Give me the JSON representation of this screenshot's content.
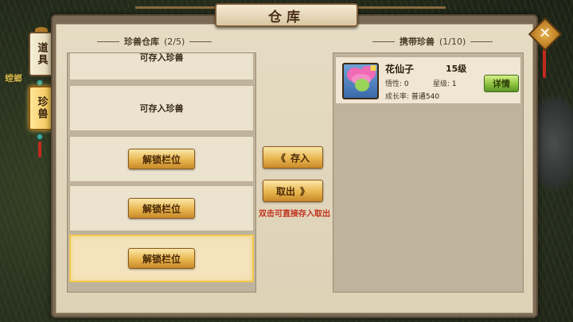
{
  "window": {
    "title": "仓库"
  },
  "side_tabs": [
    {
      "label": "道具",
      "active": false
    },
    {
      "label": "珍兽",
      "active": true
    }
  ],
  "background_label": "螳螂",
  "left": {
    "header": "珍兽仓库",
    "count": "(2/5)",
    "slots": [
      {
        "type": "empty",
        "text": "可存入珍兽"
      },
      {
        "type": "empty",
        "text": "可存入珍兽"
      },
      {
        "type": "locked",
        "button": "解锁栏位"
      },
      {
        "type": "locked",
        "button": "解锁栏位"
      },
      {
        "type": "locked",
        "button": "解锁栏位",
        "selected": true
      }
    ]
  },
  "middle": {
    "store_button": "存入",
    "take_button": "取出",
    "hint": "双击可直接存入取出",
    "store_arrows": "《",
    "take_arrows": "》"
  },
  "right": {
    "header": "携带珍兽",
    "count": "(1/10)",
    "pet": {
      "name": "花仙子",
      "level": "15级",
      "comprehension_label": "悟性:",
      "comprehension_value": "0",
      "star_label": "星级:",
      "star_value": "1",
      "growth_label": "成长率:",
      "growth_value": "普通540",
      "detail_button": "详情"
    }
  },
  "close_label": "✕",
  "colors": {
    "accent_gold": "#e8b64f",
    "detail_green": "#8cc23c",
    "hint_red": "#c0311c",
    "selected_border": "#f2c94c"
  }
}
